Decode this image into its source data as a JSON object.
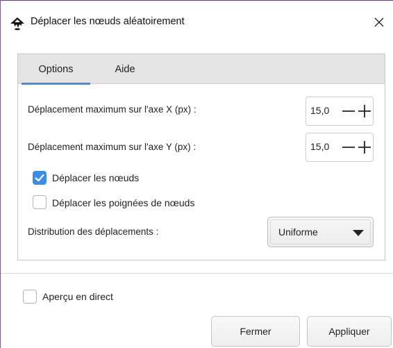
{
  "window": {
    "title": "Déplacer les nœuds aléatoirement",
    "close_glyph": "✕",
    "app_icon": "inkscape-icon"
  },
  "tabs": [
    {
      "label": "Options",
      "active": true
    },
    {
      "label": "Aide",
      "active": false
    }
  ],
  "options": {
    "max_x": {
      "label": "Déplacement maximum sur l'axe X (px) :",
      "value": "15,0"
    },
    "max_y": {
      "label": "Déplacement maximum sur l'axe Y (px) :",
      "value": "15,0"
    },
    "move_nodes": {
      "label": "Déplacer les nœuds",
      "checked": true
    },
    "move_handles": {
      "label": "Déplacer les poignées de nœuds",
      "checked": false
    },
    "distribution": {
      "label": "Distribution des déplacements :",
      "value": "Uniforme"
    }
  },
  "live_preview": {
    "label": "Aperçu en direct",
    "checked": false
  },
  "buttons": {
    "close": "Fermer",
    "apply": "Appliquer"
  },
  "colors": {
    "accent": "#3a8ee6",
    "window_border": "#7a5a92"
  }
}
